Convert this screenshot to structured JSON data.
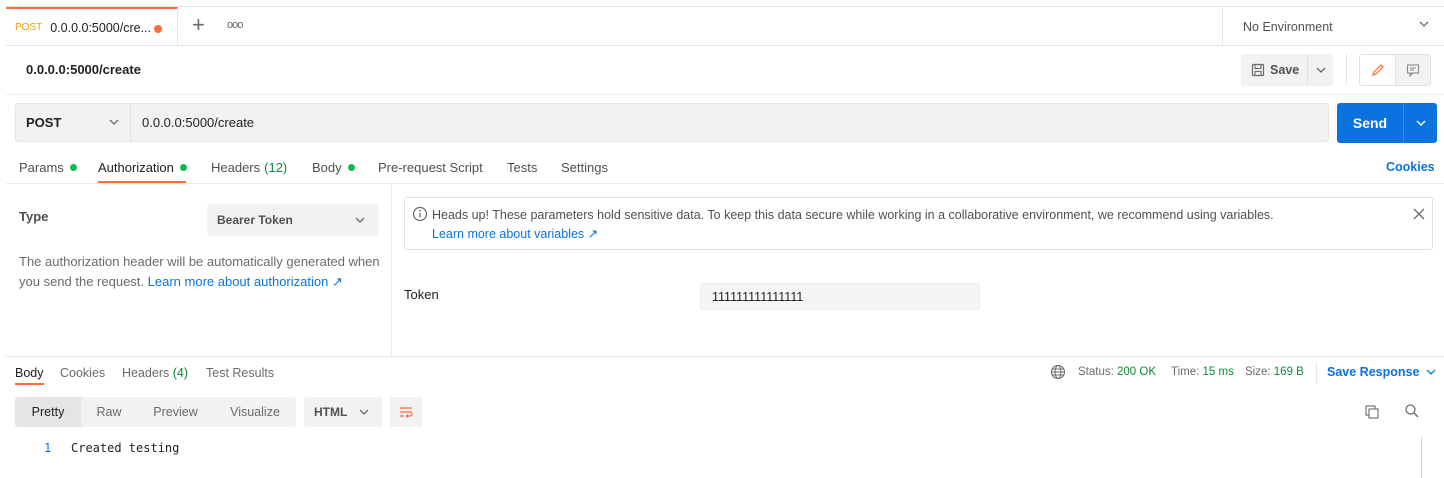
{
  "tabbar": {
    "active_tab": {
      "method": "POST",
      "url": "0.0.0.0:5000/cre..."
    },
    "plus": "+",
    "more": "ooo",
    "environment": "No Environment"
  },
  "request": {
    "title": "0.0.0.0:5000/create",
    "save_label": "Save",
    "method": "POST",
    "url": "0.0.0.0:5000/create",
    "send_label": "Send"
  },
  "req_tabs": {
    "params": "Params",
    "authorization": "Authorization",
    "headers": "Headers",
    "headers_count": "(12)",
    "body": "Body",
    "prerequest": "Pre-request Script",
    "tests": "Tests",
    "settings": "Settings",
    "cookies": "Cookies"
  },
  "auth": {
    "type_label": "Type",
    "type_value": "Bearer Token",
    "description": "The authorization header will be automatically generated when you send the request.",
    "learn_more": "Learn more about authorization ↗",
    "warning_text": "Heads up! These parameters hold sensitive data. To keep this data secure while working in a collaborative environment, we recommend using variables.",
    "warning_link": "Learn more about variables ↗",
    "token_label": "Token",
    "token_value": "111111111111111"
  },
  "response": {
    "tabs": {
      "body": "Body",
      "cookies": "Cookies",
      "headers": "Headers",
      "headers_count": "(4)",
      "test_results": "Test Results"
    },
    "status_label": "Status:",
    "status_value": "200 OK",
    "time_label": "Time:",
    "time_value": "15 ms",
    "size_label": "Size:",
    "size_value": "169 B",
    "save_response": "Save Response",
    "view_modes": {
      "pretty": "Pretty",
      "raw": "Raw",
      "preview": "Preview",
      "visualize": "Visualize"
    },
    "format": "HTML",
    "line_number": "1",
    "body_text": "Created testing"
  },
  "colors": {
    "accent": "#ff6c37",
    "primary": "#0b73e0",
    "success": "#0cbb52",
    "status_green": "#0a8a3a"
  },
  "icons": [
    "save-icon",
    "pencil-icon",
    "comment-icon",
    "info-icon",
    "close-icon",
    "globe-icon",
    "wrap-icon",
    "copy-icon",
    "search-icon",
    "chevron-down-icon"
  ]
}
